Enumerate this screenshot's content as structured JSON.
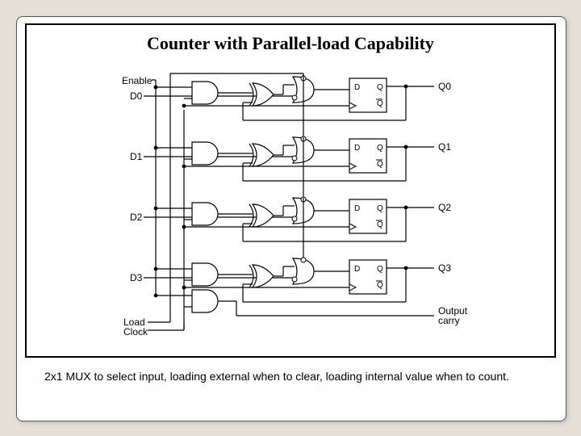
{
  "title": "Counter with Parallel-load Capability",
  "caption": "2x1 MUX to select input, loading external when to clear, loading internal value when to count.",
  "signals": {
    "enable": "Enable",
    "load": "Load",
    "clock": "Clock",
    "output": "Output",
    "carry": "carry"
  },
  "d_inputs": [
    "D0",
    "D1",
    "D2",
    "D3"
  ],
  "q_outputs": [
    "Q0",
    "Q1",
    "Q2",
    "Q3"
  ],
  "ff": {
    "d": "D",
    "q": "Q",
    "qb": "Q"
  }
}
